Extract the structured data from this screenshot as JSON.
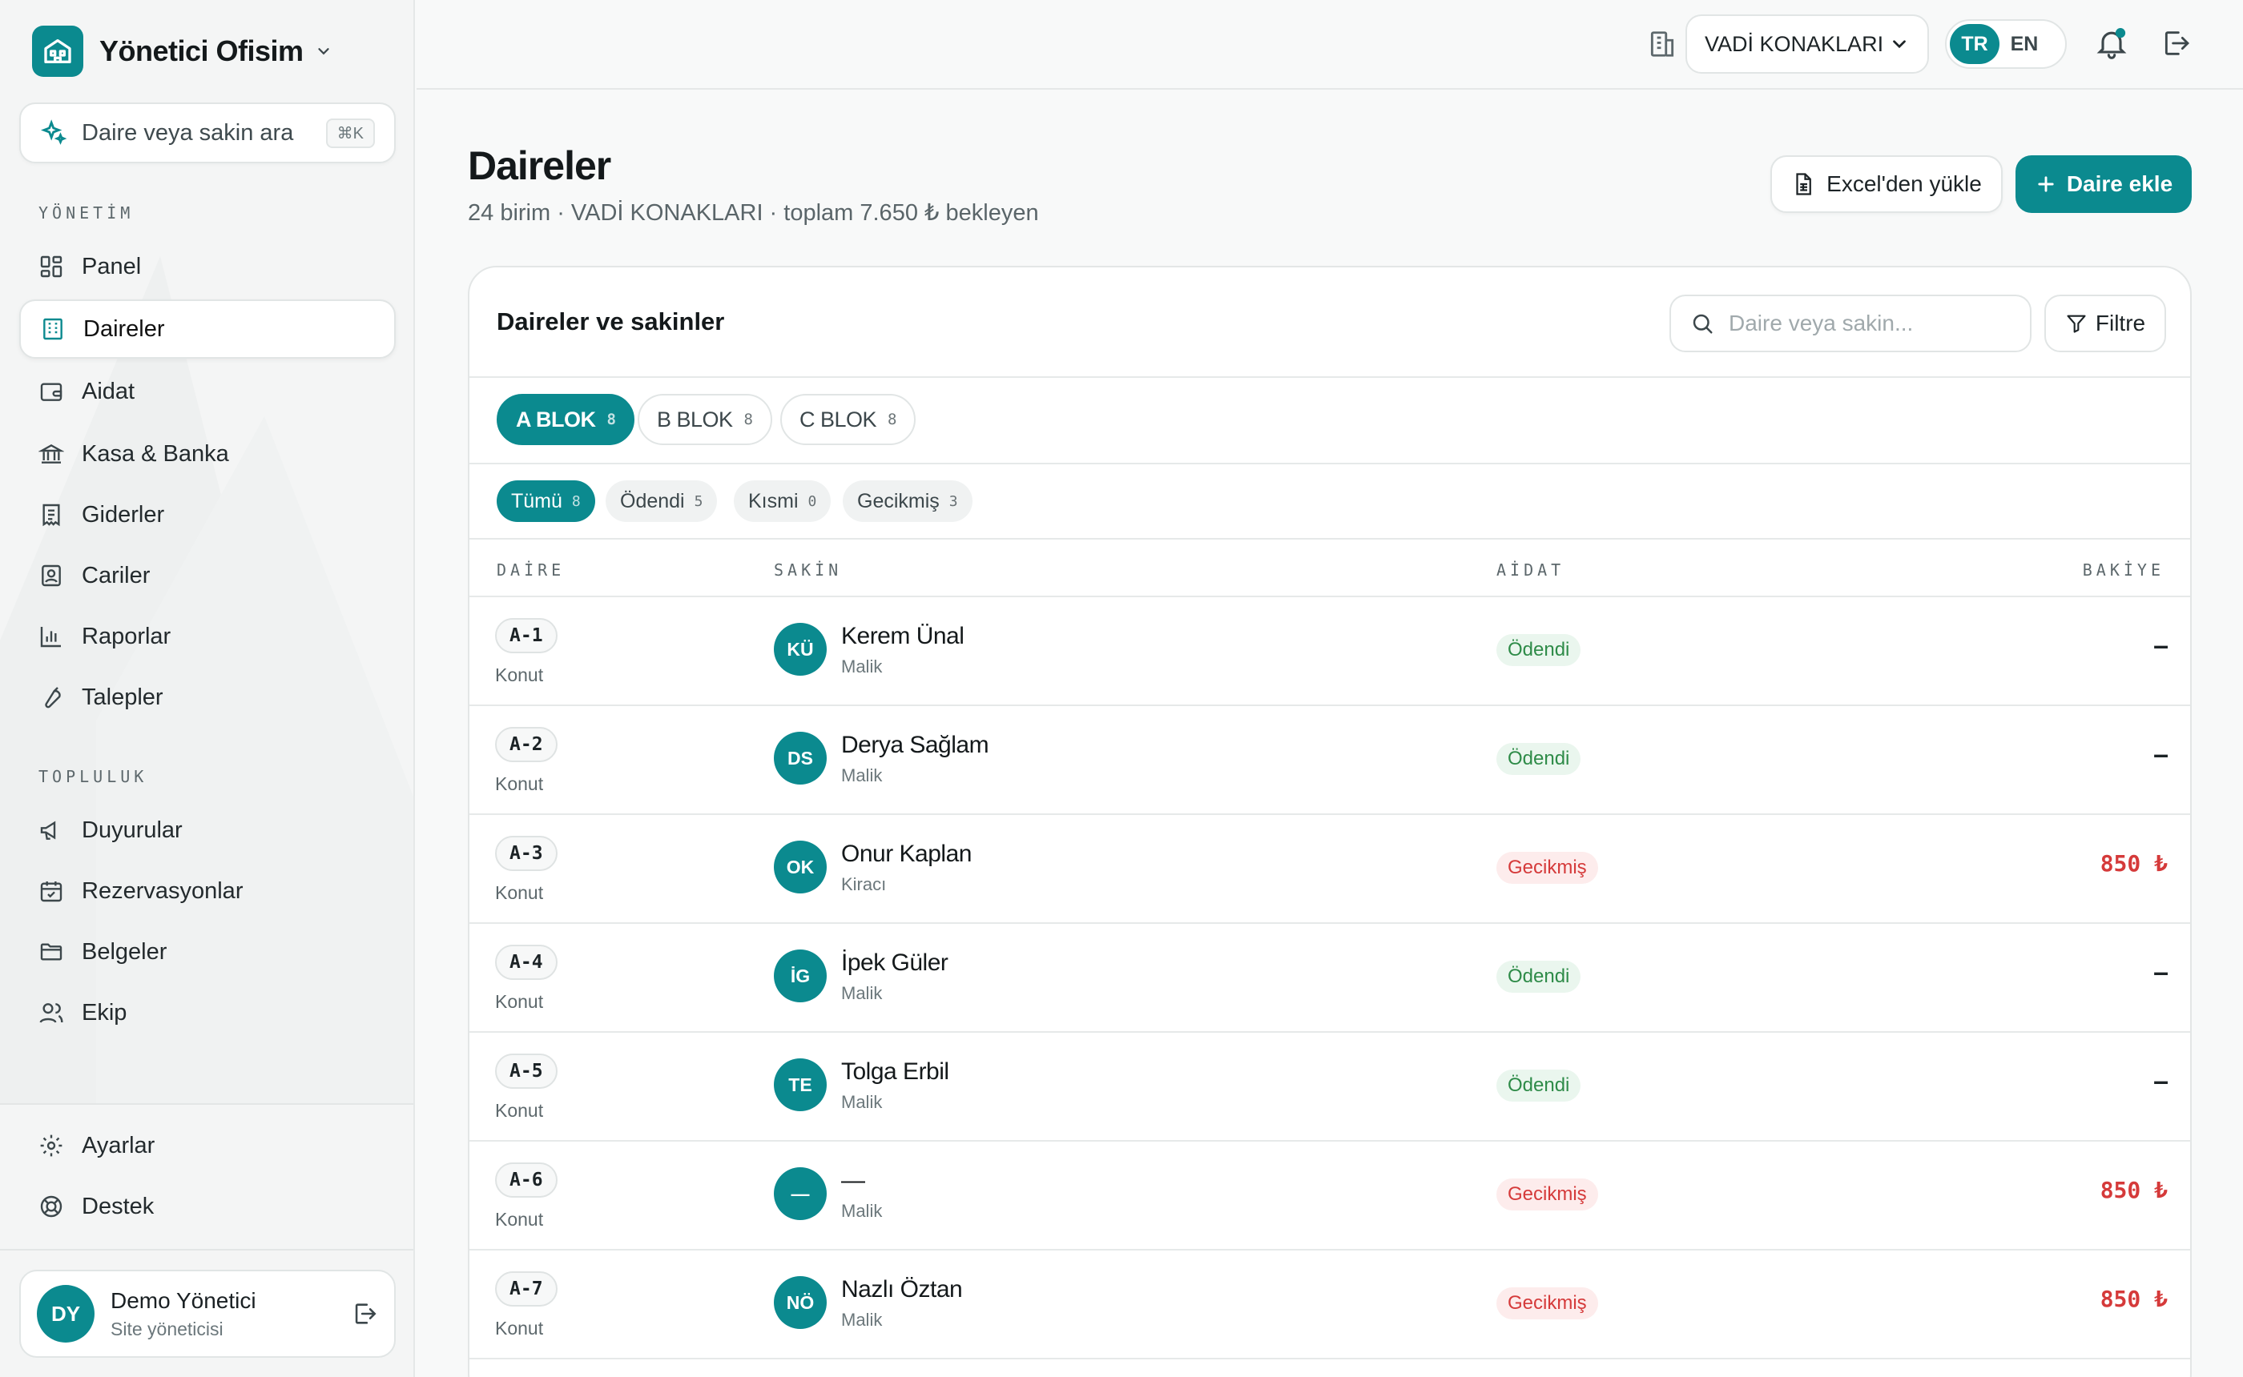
{
  "brand": {
    "name": "Yönetici Ofisim"
  },
  "sidebar_search": {
    "placeholder": "Daire veya sakin ara",
    "shortcut": "⌘K"
  },
  "sections": {
    "management": "YÖNETİM",
    "community": "TOPLULUK"
  },
  "nav_management": [
    {
      "label": "Panel",
      "icon": "dashboard-icon"
    },
    {
      "label": "Daireler",
      "icon": "building-icon",
      "active": true
    },
    {
      "label": "Aidat",
      "icon": "wallet-icon"
    },
    {
      "label": "Kasa & Banka",
      "icon": "bank-icon"
    },
    {
      "label": "Giderler",
      "icon": "receipt-icon"
    },
    {
      "label": "Cariler",
      "icon": "contact-book-icon"
    },
    {
      "label": "Raporlar",
      "icon": "bar-chart-icon"
    },
    {
      "label": "Talepler",
      "icon": "wrench-icon"
    }
  ],
  "nav_community": [
    {
      "label": "Duyurular",
      "icon": "megaphone-icon"
    },
    {
      "label": "Rezervasyonlar",
      "icon": "calendar-check-icon"
    },
    {
      "label": "Belgeler",
      "icon": "folder-icon"
    },
    {
      "label": "Ekip",
      "icon": "users-icon"
    }
  ],
  "nav_bottom": [
    {
      "label": "Ayarlar",
      "icon": "gear-icon"
    },
    {
      "label": "Destek",
      "icon": "lifebuoy-icon"
    }
  ],
  "user": {
    "initials": "DY",
    "name": "Demo Yönetici",
    "role": "Site yöneticisi"
  },
  "topbar": {
    "site": "VADİ KONAKLARI",
    "lang_tr": "TR",
    "lang_en": "EN"
  },
  "page": {
    "title": "Daireler",
    "subtitle": "24 birim · VADİ KONAKLARI · toplam 7.650 ₺ bekleyen",
    "import_button": "Excel'den yükle",
    "add_button": "Daire ekle"
  },
  "card": {
    "title": "Daireler ve sakinler",
    "search_placeholder": "Daire veya sakin...",
    "filter_button": "Filtre"
  },
  "blocks": [
    {
      "label": "A BLOK",
      "count": "8",
      "active": true
    },
    {
      "label": "B BLOK",
      "count": "8"
    },
    {
      "label": "C BLOK",
      "count": "8"
    }
  ],
  "status_filters": [
    {
      "label": "Tümü",
      "count": "8",
      "active": true
    },
    {
      "label": "Ödendi",
      "count": "5"
    },
    {
      "label": "Kısmi",
      "count": "0"
    },
    {
      "label": "Gecikmiş",
      "count": "3"
    }
  ],
  "columns": {
    "unit": "DAİRE",
    "resident": "SAKİN",
    "dues": "AİDAT",
    "balance": "BAKİYE"
  },
  "rows": [
    {
      "unit": "A-1",
      "type": "Konut",
      "initials": "KÜ",
      "name": "Kerem Ünal",
      "role": "Malik",
      "status": "Ödendi",
      "status_kind": "paid",
      "balance": "—"
    },
    {
      "unit": "A-2",
      "type": "Konut",
      "initials": "DS",
      "name": "Derya Sağlam",
      "role": "Malik",
      "status": "Ödendi",
      "status_kind": "paid",
      "balance": "—"
    },
    {
      "unit": "A-3",
      "type": "Konut",
      "initials": "OK",
      "name": "Onur Kaplan",
      "role": "Kiracı",
      "status": "Gecikmiş",
      "status_kind": "late",
      "balance": "850 ₺"
    },
    {
      "unit": "A-4",
      "type": "Konut",
      "initials": "İG",
      "name": "İpek Güler",
      "role": "Malik",
      "status": "Ödendi",
      "status_kind": "paid",
      "balance": "—"
    },
    {
      "unit": "A-5",
      "type": "Konut",
      "initials": "TE",
      "name": "Tolga Erbil",
      "role": "Malik",
      "status": "Ödendi",
      "status_kind": "paid",
      "balance": "—"
    },
    {
      "unit": "A-6",
      "type": "Konut",
      "initials": "—",
      "name": "—",
      "role": "Malik",
      "status": "Gecikmiş",
      "status_kind": "late",
      "balance": "850 ₺"
    },
    {
      "unit": "A-7",
      "type": "Konut",
      "initials": "NÖ",
      "name": "Nazlı Öztan",
      "role": "Malik",
      "status": "Gecikmiş",
      "status_kind": "late",
      "balance": "850 ₺"
    }
  ],
  "colors": {
    "accent": "#0b8a8f",
    "paid": "#2e8b48",
    "late": "#d53a3a"
  }
}
